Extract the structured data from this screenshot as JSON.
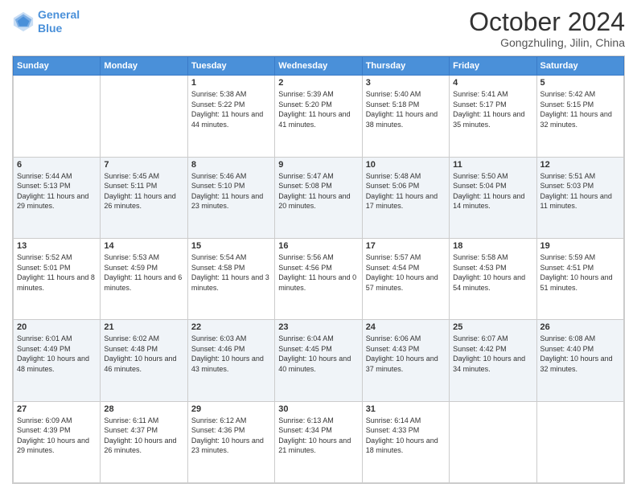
{
  "header": {
    "logo_line1": "General",
    "logo_line2": "Blue",
    "month": "October 2024",
    "location": "Gongzhuling, Jilin, China"
  },
  "weekdays": [
    "Sunday",
    "Monday",
    "Tuesday",
    "Wednesday",
    "Thursday",
    "Friday",
    "Saturday"
  ],
  "weeks": [
    [
      {
        "day": "",
        "info": ""
      },
      {
        "day": "",
        "info": ""
      },
      {
        "day": "1",
        "info": "Sunrise: 5:38 AM\nSunset: 5:22 PM\nDaylight: 11 hours and 44 minutes."
      },
      {
        "day": "2",
        "info": "Sunrise: 5:39 AM\nSunset: 5:20 PM\nDaylight: 11 hours and 41 minutes."
      },
      {
        "day": "3",
        "info": "Sunrise: 5:40 AM\nSunset: 5:18 PM\nDaylight: 11 hours and 38 minutes."
      },
      {
        "day": "4",
        "info": "Sunrise: 5:41 AM\nSunset: 5:17 PM\nDaylight: 11 hours and 35 minutes."
      },
      {
        "day": "5",
        "info": "Sunrise: 5:42 AM\nSunset: 5:15 PM\nDaylight: 11 hours and 32 minutes."
      }
    ],
    [
      {
        "day": "6",
        "info": "Sunrise: 5:44 AM\nSunset: 5:13 PM\nDaylight: 11 hours and 29 minutes."
      },
      {
        "day": "7",
        "info": "Sunrise: 5:45 AM\nSunset: 5:11 PM\nDaylight: 11 hours and 26 minutes."
      },
      {
        "day": "8",
        "info": "Sunrise: 5:46 AM\nSunset: 5:10 PM\nDaylight: 11 hours and 23 minutes."
      },
      {
        "day": "9",
        "info": "Sunrise: 5:47 AM\nSunset: 5:08 PM\nDaylight: 11 hours and 20 minutes."
      },
      {
        "day": "10",
        "info": "Sunrise: 5:48 AM\nSunset: 5:06 PM\nDaylight: 11 hours and 17 minutes."
      },
      {
        "day": "11",
        "info": "Sunrise: 5:50 AM\nSunset: 5:04 PM\nDaylight: 11 hours and 14 minutes."
      },
      {
        "day": "12",
        "info": "Sunrise: 5:51 AM\nSunset: 5:03 PM\nDaylight: 11 hours and 11 minutes."
      }
    ],
    [
      {
        "day": "13",
        "info": "Sunrise: 5:52 AM\nSunset: 5:01 PM\nDaylight: 11 hours and 8 minutes."
      },
      {
        "day": "14",
        "info": "Sunrise: 5:53 AM\nSunset: 4:59 PM\nDaylight: 11 hours and 6 minutes."
      },
      {
        "day": "15",
        "info": "Sunrise: 5:54 AM\nSunset: 4:58 PM\nDaylight: 11 hours and 3 minutes."
      },
      {
        "day": "16",
        "info": "Sunrise: 5:56 AM\nSunset: 4:56 PM\nDaylight: 11 hours and 0 minutes."
      },
      {
        "day": "17",
        "info": "Sunrise: 5:57 AM\nSunset: 4:54 PM\nDaylight: 10 hours and 57 minutes."
      },
      {
        "day": "18",
        "info": "Sunrise: 5:58 AM\nSunset: 4:53 PM\nDaylight: 10 hours and 54 minutes."
      },
      {
        "day": "19",
        "info": "Sunrise: 5:59 AM\nSunset: 4:51 PM\nDaylight: 10 hours and 51 minutes."
      }
    ],
    [
      {
        "day": "20",
        "info": "Sunrise: 6:01 AM\nSunset: 4:49 PM\nDaylight: 10 hours and 48 minutes."
      },
      {
        "day": "21",
        "info": "Sunrise: 6:02 AM\nSunset: 4:48 PM\nDaylight: 10 hours and 46 minutes."
      },
      {
        "day": "22",
        "info": "Sunrise: 6:03 AM\nSunset: 4:46 PM\nDaylight: 10 hours and 43 minutes."
      },
      {
        "day": "23",
        "info": "Sunrise: 6:04 AM\nSunset: 4:45 PM\nDaylight: 10 hours and 40 minutes."
      },
      {
        "day": "24",
        "info": "Sunrise: 6:06 AM\nSunset: 4:43 PM\nDaylight: 10 hours and 37 minutes."
      },
      {
        "day": "25",
        "info": "Sunrise: 6:07 AM\nSunset: 4:42 PM\nDaylight: 10 hours and 34 minutes."
      },
      {
        "day": "26",
        "info": "Sunrise: 6:08 AM\nSunset: 4:40 PM\nDaylight: 10 hours and 32 minutes."
      }
    ],
    [
      {
        "day": "27",
        "info": "Sunrise: 6:09 AM\nSunset: 4:39 PM\nDaylight: 10 hours and 29 minutes."
      },
      {
        "day": "28",
        "info": "Sunrise: 6:11 AM\nSunset: 4:37 PM\nDaylight: 10 hours and 26 minutes."
      },
      {
        "day": "29",
        "info": "Sunrise: 6:12 AM\nSunset: 4:36 PM\nDaylight: 10 hours and 23 minutes."
      },
      {
        "day": "30",
        "info": "Sunrise: 6:13 AM\nSunset: 4:34 PM\nDaylight: 10 hours and 21 minutes."
      },
      {
        "day": "31",
        "info": "Sunrise: 6:14 AM\nSunset: 4:33 PM\nDaylight: 10 hours and 18 minutes."
      },
      {
        "day": "",
        "info": ""
      },
      {
        "day": "",
        "info": ""
      }
    ]
  ]
}
